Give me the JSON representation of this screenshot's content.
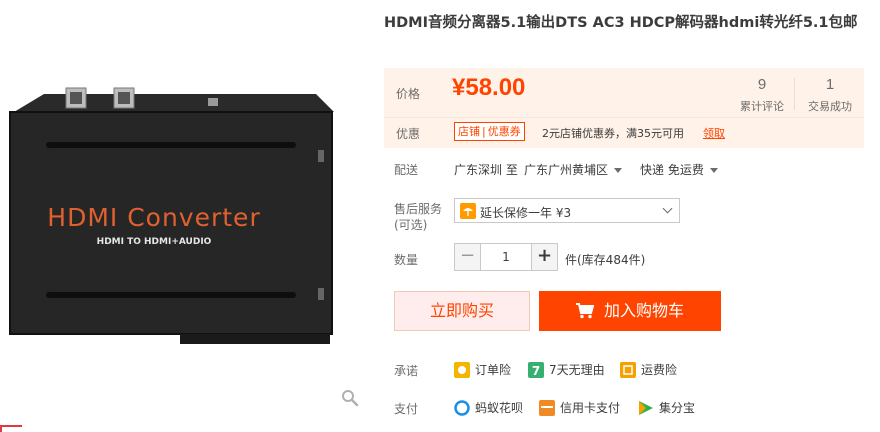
{
  "product": {
    "title": "HDMI音频分离器5.1输出DTS AC3 HDCP解码器hdmi转光纤5.1包邮",
    "image_text": {
      "brand": "HDMI Converter",
      "model": "HDMI TO HDMI+AUDIO"
    }
  },
  "price": {
    "label": "价格",
    "value": "¥58.00",
    "reviews_count": "9",
    "reviews_label": "累计评论",
    "sales_count": "1",
    "sales_label": "交易成功"
  },
  "promo": {
    "label": "优惠",
    "tag_left": "店铺",
    "tag_right": "优惠券",
    "text": "2元店铺优惠券，满35元可用",
    "link": "领取"
  },
  "shipping": {
    "label": "配送",
    "from": "广东深圳 至",
    "to": "广东广州黄埔区",
    "method": "快递 免运费"
  },
  "service": {
    "label_line1": "售后服务",
    "label_line2": "(可选)",
    "selected": "延长保修一年 ¥3"
  },
  "quantity": {
    "label": "数量",
    "minus": "−",
    "value": "1",
    "plus": "+",
    "stock": "件(库存484件)"
  },
  "actions": {
    "buy_now": "立即购买",
    "add_to_cart": "加入购物车"
  },
  "promises": {
    "label": "承诺",
    "items": [
      "订单险",
      "7天无理由",
      "运费险"
    ]
  },
  "payment": {
    "label": "支付",
    "items": [
      "蚂蚁花呗",
      "信用卡支付",
      "集分宝"
    ]
  },
  "colors": {
    "accent": "#ff4400",
    "price_bg": "#fff2e8"
  }
}
